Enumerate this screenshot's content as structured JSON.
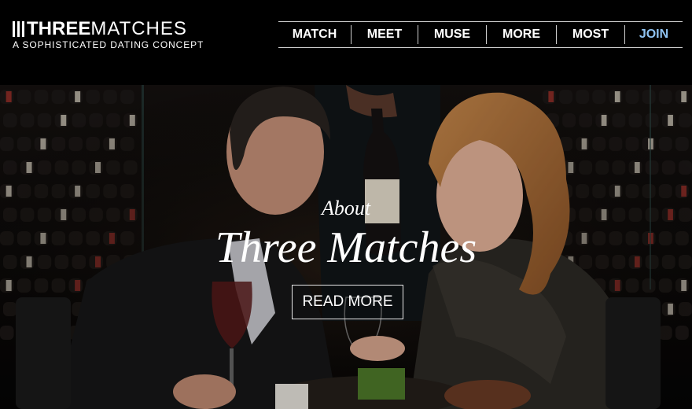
{
  "logo": {
    "bold_text": "THREE",
    "light_text": "MATCHES",
    "tagline": "A SOPHISTICATED DATING CONCEPT"
  },
  "nav": {
    "items": [
      {
        "label": "MATCH",
        "color": "#ffffff"
      },
      {
        "label": "MEET",
        "color": "#ffffff"
      },
      {
        "label": "MUSE",
        "color": "#ffffff"
      },
      {
        "label": "MORE",
        "color": "#ffffff"
      },
      {
        "label": "MOST",
        "color": "#ffffff"
      },
      {
        "label": "JOIN",
        "color": "#8fc3f2"
      }
    ]
  },
  "hero": {
    "subtitle": "About",
    "title": "Three Matches",
    "button_label": "READ MORE"
  }
}
